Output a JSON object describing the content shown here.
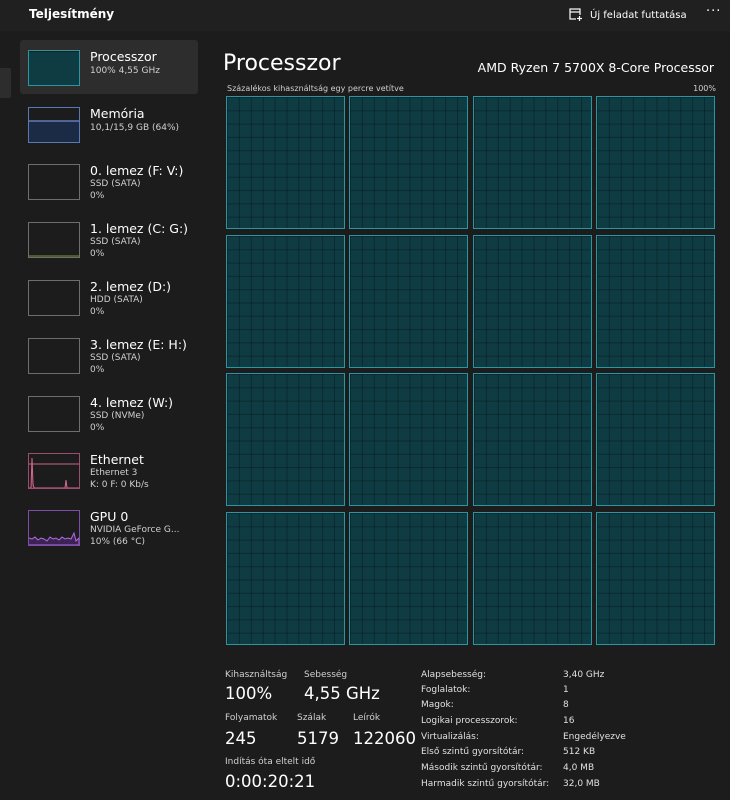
{
  "header": {
    "title": "Teljesítmény",
    "run_task_label": "Új feladat futtatása",
    "more": "···"
  },
  "sidebar": {
    "items": [
      {
        "name": "Processzor",
        "sub1": "100%  4,55 GHz",
        "sub2": "",
        "sub3": ""
      },
      {
        "name": "Memória",
        "sub1": "10,1/15,9 GB (64%)",
        "sub2": "",
        "sub3": ""
      },
      {
        "name": "0. lemez (F: V:)",
        "sub1": "SSD (SATA)",
        "sub2": "0%",
        "sub3": ""
      },
      {
        "name": "1. lemez (C: G:)",
        "sub1": "SSD (SATA)",
        "sub2": "0%",
        "sub3": ""
      },
      {
        "name": "2. lemez (D:)",
        "sub1": "HDD (SATA)",
        "sub2": "0%",
        "sub3": ""
      },
      {
        "name": "3. lemez (E: H:)",
        "sub1": "SSD (SATA)",
        "sub2": "0%",
        "sub3": ""
      },
      {
        "name": "4. lemez (W:)",
        "sub1": "SSD (NVMe)",
        "sub2": "0%",
        "sub3": ""
      },
      {
        "name": "Ethernet",
        "sub1": "Ethernet 3",
        "sub2": "K: 0 F: 0 Kb/s",
        "sub3": ""
      },
      {
        "name": "GPU 0",
        "sub1": "NVIDIA GeForce G...",
        "sub2": "10% (66 °C)",
        "sub3": ""
      }
    ]
  },
  "main": {
    "title": "Processzor",
    "cpu_name": "AMD Ryzen 7 5700X 8-Core Processor",
    "graph_label": "Százalékos kihasználtság egy percre vetítve",
    "graph_max": "100%",
    "core_count": 16,
    "core_utilization": 1.0,
    "colors": {
      "accent": "#2b96a2",
      "graph_fill": "#0f3b43"
    }
  },
  "stats": {
    "util_label": "Kihasználtság",
    "util_value": "100%",
    "speed_label": "Sebesség",
    "speed_value": "4,55 GHz",
    "proc_label": "Folyamatok",
    "proc_value": "245",
    "threads_label": "Szálak",
    "threads_value": "5179",
    "handles_label": "Leírók",
    "handles_value": "122060",
    "uptime_label": "Indítás óta eltelt idő",
    "uptime_value": "0:00:20:21"
  },
  "details": [
    {
      "key": "Alapsebesség:",
      "value": "3,40 GHz"
    },
    {
      "key": "Foglalatok:",
      "value": "1"
    },
    {
      "key": "Magok:",
      "value": "8"
    },
    {
      "key": "Logikai processzorok:",
      "value": "16"
    },
    {
      "key": "Virtualizálás:",
      "value": "Engedélyezve"
    },
    {
      "key": "Első szintű gyorsítótár:",
      "value": "512 KB"
    },
    {
      "key": "Második szintű gyorsítótár:",
      "value": "4,0 MB"
    },
    {
      "key": "Harmadik szintű gyorsítótár:",
      "value": "32,0 MB"
    }
  ]
}
